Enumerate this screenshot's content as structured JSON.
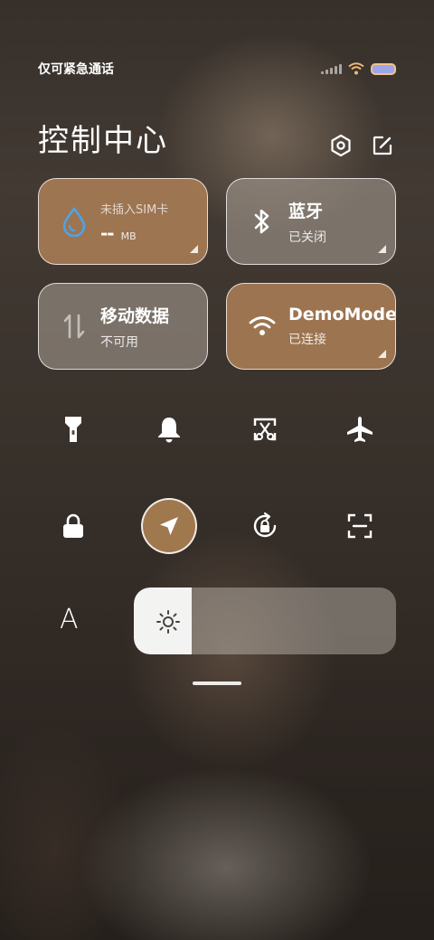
{
  "status_bar": {
    "carrier": "仅可紧急通话"
  },
  "header": {
    "title": "控制中心"
  },
  "tiles": {
    "data_usage": {
      "top_label": "未插入SIM卡",
      "value": "--",
      "unit": "MB"
    },
    "bluetooth": {
      "label": "蓝牙",
      "status": "已关闭"
    },
    "mobile_data": {
      "label": "移动数据",
      "status": "不可用"
    },
    "wifi": {
      "label": "DemoMode",
      "status": "已连接"
    }
  },
  "quick_toggles": [
    "flashlight-icon",
    "bell-icon",
    "screenshot-icon",
    "airplane-icon",
    "lock-icon",
    "location-icon",
    "auto-rotate-icon",
    "scan-icon"
  ],
  "brightness": {
    "font_label": "A",
    "level": 0.22
  },
  "colors": {
    "accent": "#a0784e",
    "tile_brown": "#aa7d55",
    "water_icon": "#4fa3e6"
  }
}
